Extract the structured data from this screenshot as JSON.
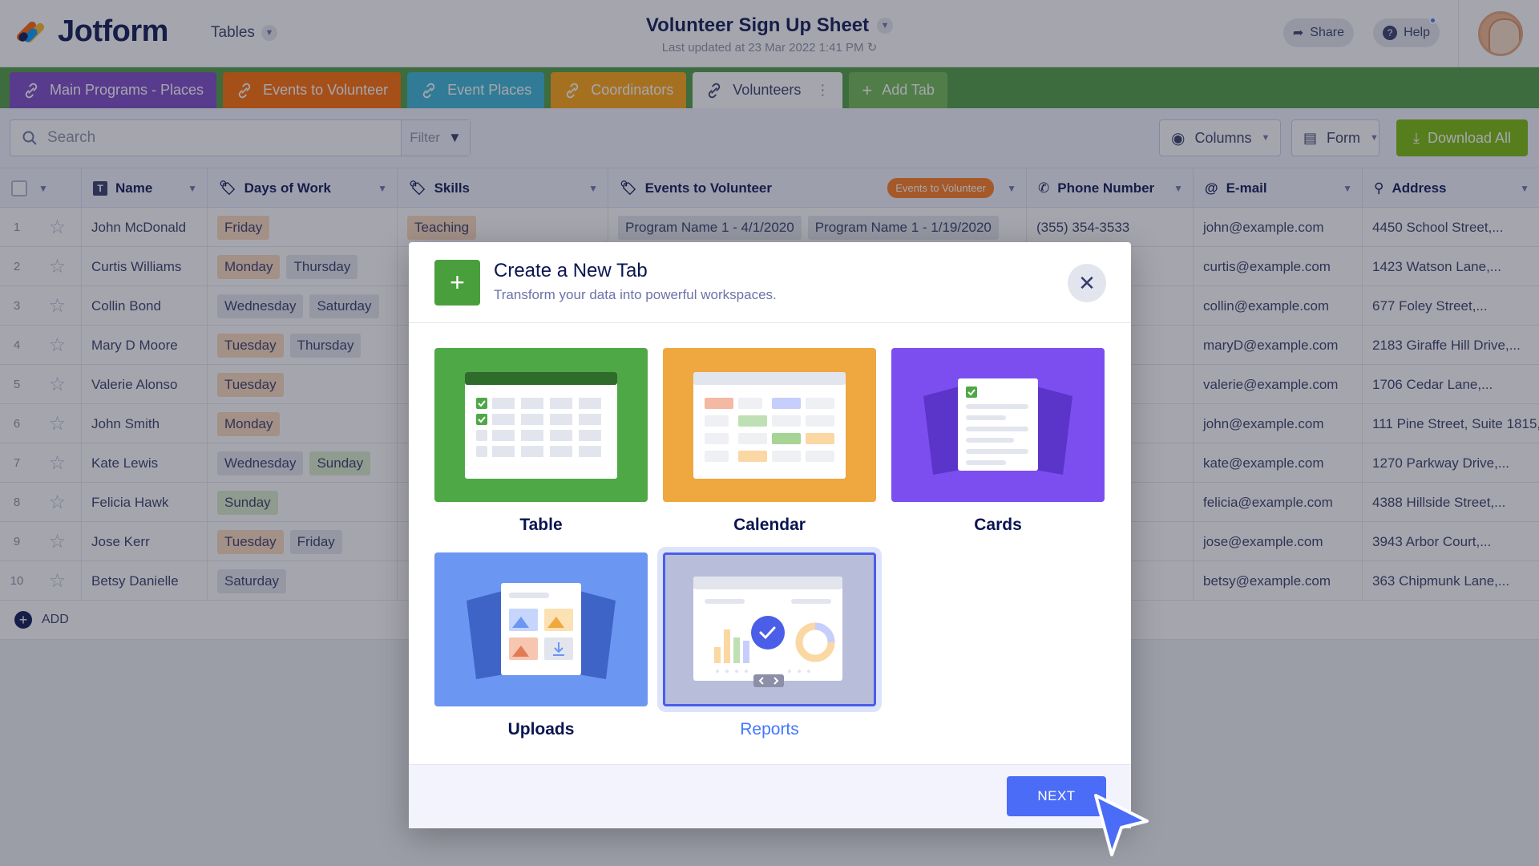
{
  "header": {
    "brand": "Jotform",
    "section": "Tables",
    "title": "Volunteer Sign Up Sheet",
    "subtitle": "Last updated at 23 Mar 2022 1:41 PM",
    "share": "Share",
    "help": "Help"
  },
  "tabs": [
    {
      "label": "Main Programs - Places",
      "color": "#7a47c9"
    },
    {
      "label": "Events to Volunteer",
      "color": "#ff6a00"
    },
    {
      "label": "Event Places",
      "color": "#38b6d7"
    },
    {
      "label": "Coordinators",
      "color": "#ffa40e"
    },
    {
      "label": "Volunteers",
      "color": "#ffffff"
    },
    {
      "label": "Add Tab",
      "color": "#6eb954"
    }
  ],
  "toolbar": {
    "search_placeholder": "Search",
    "filter": "Filter",
    "columns": "Columns",
    "form": "Form",
    "download": "Download All"
  },
  "table": {
    "columns": [
      "Name",
      "Days of Work",
      "Skills",
      "Events to Volunteer",
      "Phone Number",
      "E-mail",
      "Address"
    ],
    "events_pill": "Events to Volunteer",
    "rows": [
      {
        "n": "1",
        "name": "John McDonald",
        "days": [
          "Friday"
        ],
        "skills": "Teaching",
        "events": [
          "Program Name 1 - 4/1/2020",
          "Program Name 1 - 1/19/2020"
        ],
        "phone": "(355) 354-3533",
        "email": "john@example.com",
        "address": "4450 School Street,..."
      },
      {
        "n": "2",
        "name": "Curtis Williams",
        "days": [
          "Monday",
          "Thursday"
        ],
        "skills": "",
        "events": [],
        "phone": "",
        "email": "curtis@example.com",
        "address": "1423 Watson Lane,..."
      },
      {
        "n": "3",
        "name": "Collin Bond",
        "days": [
          "Wednesday",
          "Saturday"
        ],
        "skills": "",
        "events": [],
        "phone": "",
        "email": "collin@example.com",
        "address": "677 Foley Street,..."
      },
      {
        "n": "4",
        "name": "Mary D Moore",
        "days": [
          "Tuesday",
          "Thursday"
        ],
        "skills": "",
        "events": [],
        "phone": "",
        "email": "maryD@example.com",
        "address": "2183 Giraffe Hill Drive,..."
      },
      {
        "n": "5",
        "name": "Valerie Alonso",
        "days": [
          "Tuesday"
        ],
        "skills": "",
        "events": [],
        "phone": "",
        "email": "valerie@example.com",
        "address": "1706 Cedar Lane,..."
      },
      {
        "n": "6",
        "name": "John Smith",
        "days": [
          "Monday"
        ],
        "skills": "",
        "events": [],
        "phone": "",
        "email": "john@example.com",
        "address": "111 Pine Street, Suite 1815,..."
      },
      {
        "n": "7",
        "name": "Kate Lewis",
        "days": [
          "Wednesday",
          "Sunday"
        ],
        "skills": "",
        "events": [],
        "phone": "",
        "email": "kate@example.com",
        "address": "1270 Parkway Drive,..."
      },
      {
        "n": "8",
        "name": "Felicia Hawk",
        "days": [
          "Sunday"
        ],
        "skills": "",
        "events": [],
        "phone": "",
        "email": "felicia@example.com",
        "address": "4388 Hillside Street,..."
      },
      {
        "n": "9",
        "name": "Jose Kerr",
        "days": [
          "Tuesday",
          "Friday"
        ],
        "skills": "",
        "events": [],
        "phone": "",
        "email": "jose@example.com",
        "address": "3943 Arbor Court,..."
      },
      {
        "n": "10",
        "name": "Betsy Danielle",
        "days": [
          "Saturday"
        ],
        "skills": "",
        "events": [],
        "phone": "",
        "email": "betsy@example.com",
        "address": "363 Chipmunk Lane,..."
      }
    ],
    "add_label": "ADD"
  },
  "modal": {
    "title": "Create a New Tab",
    "subtitle": "Transform your data into powerful workspaces.",
    "options": [
      {
        "label": "Table",
        "color": "#4fa846",
        "selected": false
      },
      {
        "label": "Calendar",
        "color": "#efa73f",
        "selected": false
      },
      {
        "label": "Cards",
        "color": "#7c4ef0",
        "selected": false
      },
      {
        "label": "Uploads",
        "color": "#6b96f2",
        "selected": false
      },
      {
        "label": "Reports",
        "color": "#b8bdd9",
        "selected": true
      }
    ],
    "next": "NEXT"
  }
}
